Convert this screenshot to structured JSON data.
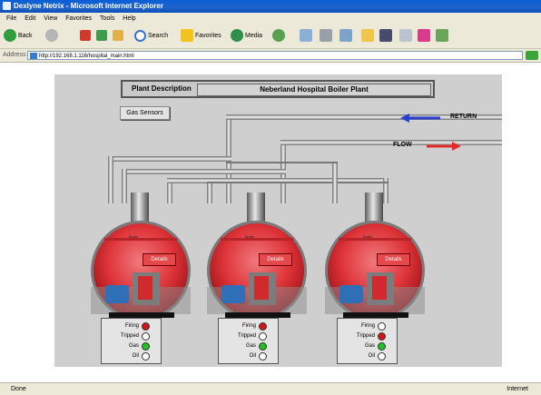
{
  "window": {
    "title": "Dexlyne Netrix - Microsoft Internet Explorer"
  },
  "menu": [
    "File",
    "Edit",
    "View",
    "Favorites",
    "Tools",
    "Help"
  ],
  "toolbar": {
    "back": "Back",
    "search": "Search",
    "favorites": "Favorites",
    "media": "Media"
  },
  "address": {
    "label": "Address",
    "url": "http://192.168.1.116/hospital_main.html"
  },
  "status": {
    "left": "Done",
    "right": "Internet"
  },
  "plant": {
    "desc_label": "Plant Description",
    "desc_value": "Neberland Hospital Boiler Plant"
  },
  "gas_sensors_label": "Gas Sensors",
  "legend": {
    "return_label": "RETURN",
    "flow_label": "FLOW",
    "return_color": "#2b3fd1",
    "flow_color": "#e32a2a"
  },
  "boilers": [
    {
      "label": "Boiler",
      "details": "Details",
      "status": [
        {
          "name": "Firing",
          "color": "#d01818"
        },
        {
          "name": "Tripped",
          "color": "#ffffff"
        },
        {
          "name": "Gas",
          "color": "#20c020"
        },
        {
          "name": "Oil",
          "color": "#ffffff"
        }
      ]
    },
    {
      "label": "Boiler",
      "details": "Details",
      "status": [
        {
          "name": "Firing",
          "color": "#d01818"
        },
        {
          "name": "Tripped",
          "color": "#ffffff"
        },
        {
          "name": "Gas",
          "color": "#20c020"
        },
        {
          "name": "Oil",
          "color": "#ffffff"
        }
      ]
    },
    {
      "label": "Boiler",
      "details": "Details",
      "status": [
        {
          "name": "Firing",
          "color": "#ffffff"
        },
        {
          "name": "Tripped",
          "color": "#d01818"
        },
        {
          "name": "Gas",
          "color": "#20c020"
        },
        {
          "name": "Oil",
          "color": "#ffffff"
        }
      ]
    }
  ]
}
